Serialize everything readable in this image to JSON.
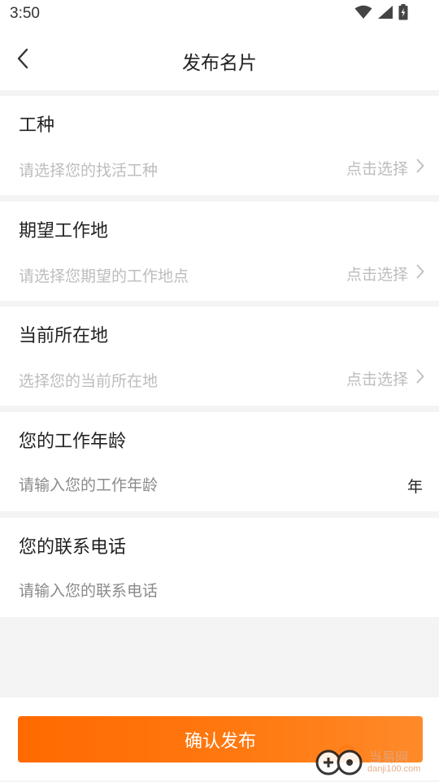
{
  "status_bar": {
    "time": "3:50",
    "icons": [
      "wifi-icon",
      "signal-icon",
      "battery-icon"
    ]
  },
  "header": {
    "title": "发布名片",
    "back_icon": "chevron-left-icon"
  },
  "sections": [
    {
      "title": "工种",
      "placeholder": "请选择您的找活工种",
      "action": "点击选择"
    },
    {
      "title": "期望工作地",
      "placeholder": "请选择您期望的工作地点",
      "action": "点击选择"
    },
    {
      "title": "当前所在地",
      "placeholder": "选择您的当前所在地",
      "action": "点击选择"
    },
    {
      "title": "您的工作年龄",
      "placeholder": "请输入您的工作年龄",
      "value": "",
      "suffix": "年"
    },
    {
      "title": "您的联系电话",
      "placeholder": "请输入您的联系电话",
      "value": ""
    }
  ],
  "footer": {
    "confirm_label": "确认发布"
  },
  "watermark": {
    "brand": "当易网",
    "domain": "danji100.com"
  },
  "colors": {
    "accent": "#ff6a00",
    "background": "#f4f4f4",
    "placeholder": "#bdbdbd",
    "text": "#222222"
  }
}
